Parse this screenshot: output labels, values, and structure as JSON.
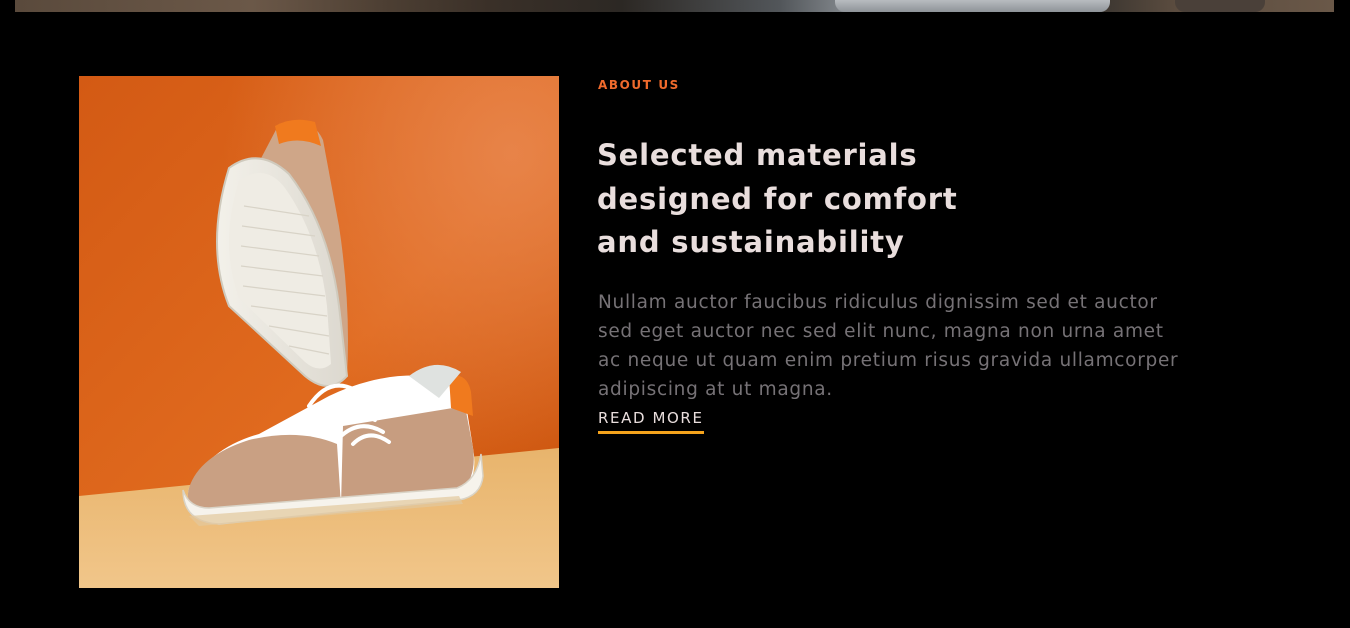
{
  "hero": {
    "image": "stones-and-shoe-photo"
  },
  "about": {
    "eyebrow": "ABOUT US",
    "heading_lines": [
      "Selected materials",
      "designed for comfort",
      "and sustainability"
    ],
    "body_lines": [
      "Nullam auctor faucibus ridiculus dignissim sed et auctor",
      "sed eget auctor nec sed elit nunc, magna non urna amet",
      "ac neque ut quam enim pretium risus gravida ullamcorper",
      "adipiscing at ut magna."
    ],
    "read_more_label": "READ MORE",
    "image": "sneakers-on-orange-background-photo"
  },
  "colors": {
    "background": "#000000",
    "accent_orange": "#ef6a2c",
    "underline_yellow": "#f5a31c",
    "heading_text": "#e9dedd",
    "body_text": "#767276"
  }
}
